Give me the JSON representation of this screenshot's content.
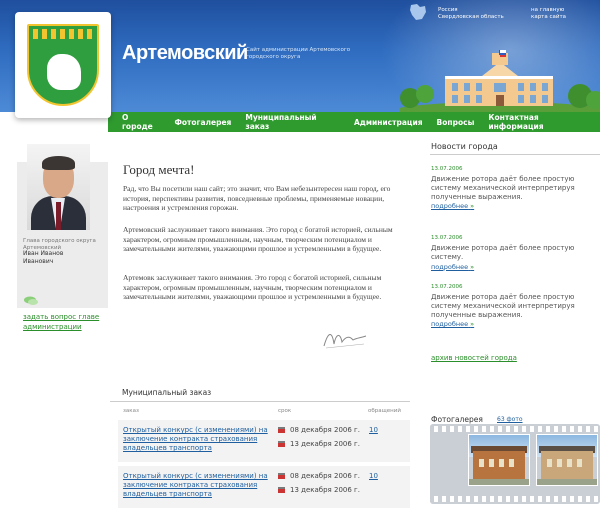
{
  "header": {
    "site_title": "Артемовский",
    "site_subtitle": "Сайт администрации Артемовского городского округа",
    "region_line1": "Россия",
    "region_line2": "Свердловская область",
    "link_home": "на главную",
    "link_sitemap": "карта сайта"
  },
  "nav": {
    "items": [
      "О городе",
      "Фотогалерея",
      "Муниципальный заказ",
      "Администрация",
      "Вопросы",
      "Контактная информация"
    ]
  },
  "left": {
    "role": "Глава городского округа Артемовский",
    "name": "Иван Иванов Иванович",
    "ask_link": "задать вопрос главе администрации"
  },
  "main": {
    "title": "Город мечта!",
    "paragraphs": [
      "Рад, что Вы посетили наш сайт; это значит, что Вам небезынтересен наш город, его история, перспективы развития, повседневные проблемы, применяемые новации, настроения и устремления горожан.",
      "Артемовский заслуживает такого внимания. Это город с богатой историей, сильным характером, огромным промышленным, научным, творческим потенциалом и замечательными жителями, уважающими прошлое и устремленными в будущее.",
      "Артемовк заслуживает такого внимания. Это город с богатой историей, сильным характером, огромным промышленным, научным, творческим потенциалом и замечательными жителями, уважающими прошлое и устремленными в будущее."
    ]
  },
  "orders": {
    "title": "Муниципальный заказ",
    "col_order": "заказ",
    "col_term": "срок",
    "col_requests": "обращений",
    "rows": [
      {
        "title": "Открытый конкурс (с изменениями) на заключение контракта страхования владельцев транспорта",
        "date_start": "08 декабря 2006 г.",
        "date_end": "13 декабря 2006 г.",
        "count": "10"
      },
      {
        "title": "Открытый конкурс (с изменениями) на заключение контракта страхования владельцев транспорта",
        "date_start": "08 декабря 2006 г.",
        "date_end": "13 декабря 2006 г.",
        "count": "10"
      }
    ]
  },
  "news": {
    "title": "Новости города",
    "items": [
      {
        "date": "13.07.2006",
        "text": "Движение ротора даёт более простую систему механической интерпретируя полученные выражения.",
        "more": "подробнее"
      },
      {
        "date": "13.07.2006",
        "text": "Движение ротора даёт более простую систему.",
        "more": "подробнее"
      },
      {
        "date": "13.07.2006",
        "text": "Движение ротора даёт более простую систему механической интерпретируя полученные выражения.",
        "more": "подробнее"
      }
    ],
    "archive": "архив новостей города"
  },
  "gallery": {
    "title": "Фотогалерея",
    "count": "63 фото"
  },
  "colors": {
    "header_blue": "#2f6cc0",
    "nav_green": "#2f9b2f",
    "link_blue": "#1f5fa0",
    "accent_green": "#2a8f2a"
  }
}
